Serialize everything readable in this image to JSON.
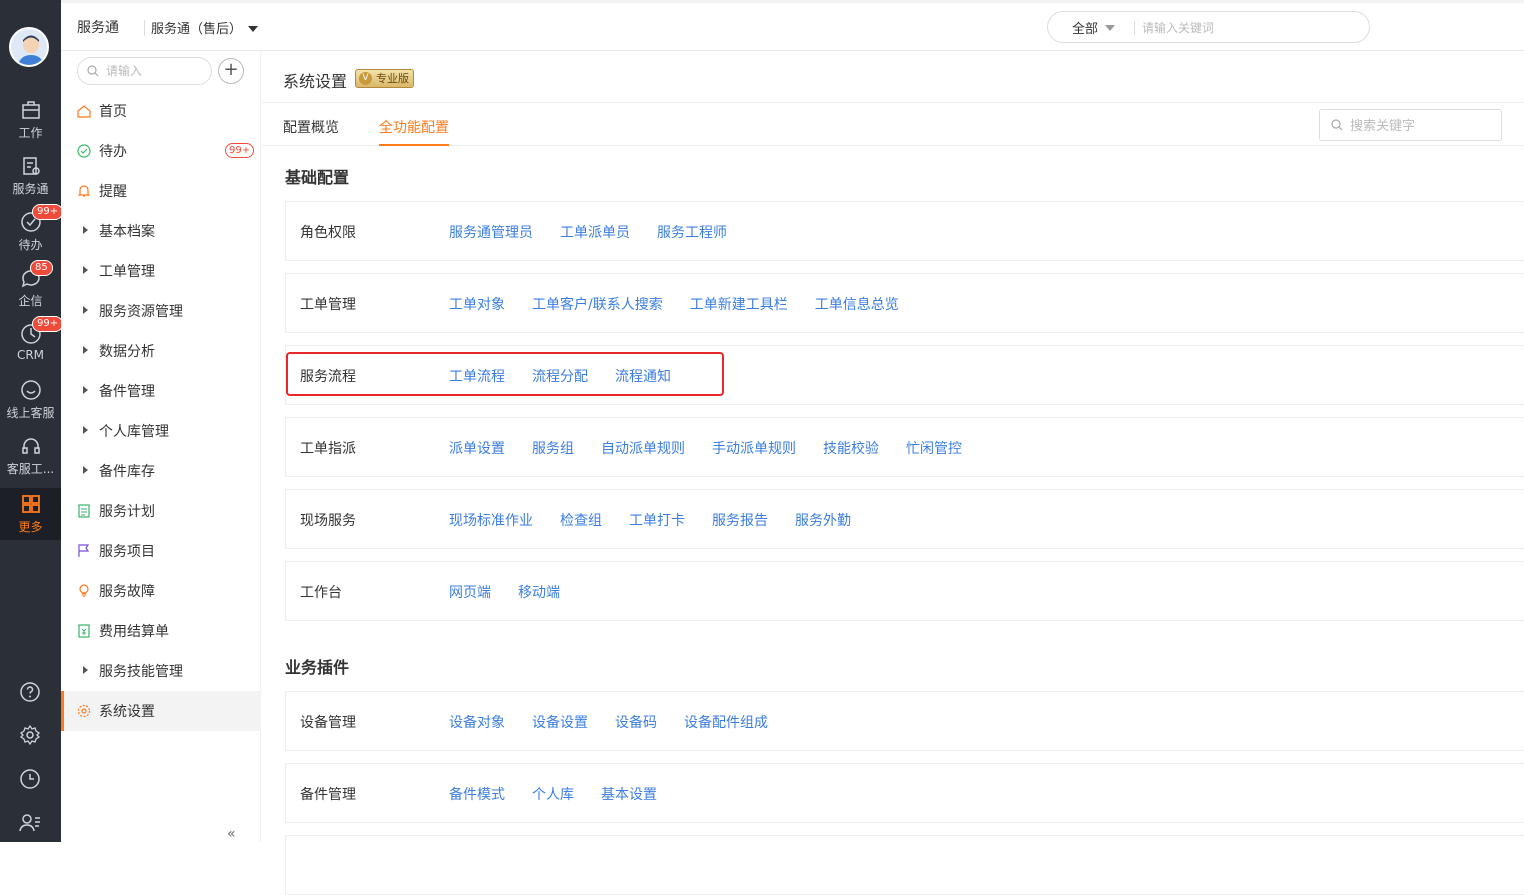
{
  "rail": {
    "items": [
      {
        "label": "工作",
        "icon": "briefcase-icon"
      },
      {
        "label": "服务通",
        "icon": "service-doc-icon"
      },
      {
        "label": "待办",
        "icon": "check-circle-icon",
        "badge": "99+"
      },
      {
        "label": "企信",
        "icon": "chat-bubble-icon",
        "badge": "85"
      },
      {
        "label": "CRM",
        "icon": "crm-icon",
        "badge": "99+"
      },
      {
        "label": "线上客服",
        "icon": "smile-chat-icon"
      },
      {
        "label": "客服工...",
        "icon": "headset-icon"
      },
      {
        "label": "更多",
        "icon": "grid-icon",
        "active": true
      }
    ],
    "bottom_icons": [
      "help-icon",
      "settings-icon",
      "clock-icon",
      "contacts-icon"
    ],
    "active_color": "#ff7a1c"
  },
  "topbar": {
    "app_name": "服务通",
    "app_select": "服务通（售后）",
    "search_scope": "全部",
    "search_placeholder": "请输入关键词"
  },
  "sidebar": {
    "search_placeholder": "请输入",
    "add_label": "+",
    "collapse_label": "«",
    "items": [
      {
        "label": "首页",
        "icon": "home-icon"
      },
      {
        "label": "待办",
        "icon": "check-circle-icon",
        "badge": "99+"
      },
      {
        "label": "提醒",
        "icon": "bell-icon"
      },
      {
        "label": "基本档案",
        "icon": "caret-right-icon"
      },
      {
        "label": "工单管理",
        "icon": "caret-right-icon"
      },
      {
        "label": "服务资源管理",
        "icon": "caret-right-icon"
      },
      {
        "label": "数据分析",
        "icon": "caret-right-icon"
      },
      {
        "label": "备件管理",
        "icon": "caret-right-icon"
      },
      {
        "label": "个人库管理",
        "icon": "caret-right-icon"
      },
      {
        "label": "备件库存",
        "icon": "caret-right-icon"
      },
      {
        "label": "服务计划",
        "icon": "plan-icon"
      },
      {
        "label": "服务项目",
        "icon": "flag-icon"
      },
      {
        "label": "服务故障",
        "icon": "bulb-icon"
      },
      {
        "label": "费用结算单",
        "icon": "bill-icon"
      },
      {
        "label": "服务技能管理",
        "icon": "caret-right-icon"
      },
      {
        "label": "系统设置",
        "icon": "gear-icon",
        "active": true
      }
    ]
  },
  "main": {
    "page_title": "系统设置",
    "edition_badge": "专业版",
    "edition_badge_mark": "V",
    "tabs": [
      {
        "label": "配置概览"
      },
      {
        "label": "全功能配置",
        "active": true
      }
    ],
    "key_search_placeholder": "搜索关键字",
    "sections": [
      {
        "title": "基础配置",
        "rows": [
          {
            "label": "角色权限",
            "links": [
              "服务通管理员",
              "工单派单员",
              "服务工程师"
            ]
          },
          {
            "label": "工单管理",
            "links": [
              "工单对象",
              "工单客户/联系人搜索",
              "工单新建工具栏",
              "工单信息总览"
            ]
          },
          {
            "label": "服务流程",
            "links": [
              "工单流程",
              "流程分配",
              "流程通知"
            ],
            "highlighted": true
          },
          {
            "label": "工单指派",
            "links": [
              "派单设置",
              "服务组",
              "自动派单规则",
              "手动派单规则",
              "技能校验",
              "忙闲管控"
            ]
          },
          {
            "label": "现场服务",
            "links": [
              "现场标准作业",
              "检查组",
              "工单打卡",
              "服务报告",
              "服务外勤"
            ]
          },
          {
            "label": "工作台",
            "links": [
              "网页端",
              "移动端"
            ]
          }
        ]
      },
      {
        "title": "业务插件",
        "rows": [
          {
            "label": "设备管理",
            "links": [
              "设备对象",
              "设备设置",
              "设备码",
              "设备配件组成"
            ]
          },
          {
            "label": "备件管理",
            "links": [
              "备件模式",
              "个人库",
              "基本设置"
            ]
          }
        ]
      }
    ],
    "link_color": "#3c7ee0",
    "highlight_color": "#e8272a"
  }
}
